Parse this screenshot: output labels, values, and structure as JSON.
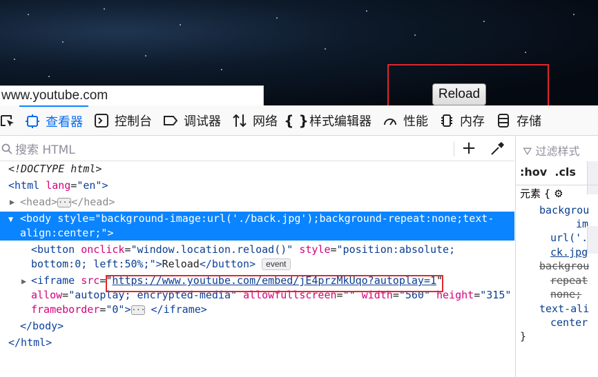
{
  "page": {
    "url_tooltip": "www.youtube.com",
    "reload_button": "Reload"
  },
  "toolbar": {
    "items": [
      {
        "label": "",
        "icon": "pick-element-icon"
      },
      {
        "label": "查看器",
        "icon": "inspector-icon",
        "active": true
      },
      {
        "label": "控制台",
        "icon": "console-icon"
      },
      {
        "label": "调试器",
        "icon": "debugger-icon"
      },
      {
        "label": "网络",
        "icon": "network-icon"
      },
      {
        "label": "样式编辑器",
        "icon": "style-editor-icon"
      },
      {
        "label": "性能",
        "icon": "performance-icon"
      },
      {
        "label": "内存",
        "icon": "memory-icon"
      },
      {
        "label": "存储",
        "icon": "storage-icon"
      }
    ]
  },
  "search": {
    "placeholder": "搜索 HTML"
  },
  "dom": {
    "doctype": "<!DOCTYPE html>",
    "html_open": "<html",
    "html_lang_attr": "lang",
    "html_lang_val": "\"en\"",
    "gt": ">",
    "head_open": "<head>",
    "head_close": "</head>",
    "body_open": "<body",
    "body_style_attr": "style",
    "body_style_val_1": "\"background-image:url('./back.jpg');background-repeat:none;text-",
    "body_style_val_2": "align:center;\"",
    "button_open": "<button",
    "button_onclick_attr": "onclick",
    "button_onclick_val": "\"window.location.reload()\"",
    "button_style_attr": "style",
    "button_style_val_1": "\"position:absolute;",
    "button_style_val_2": "bottom:0; left:50%;\"",
    "button_text": "Reload",
    "button_close": "</button>",
    "event_badge": "event",
    "iframe_open": "<iframe",
    "iframe_src_attr": "src",
    "iframe_src_val": "https://www.youtube.com/embed/jE4przMkUqo?autoplay=1",
    "iframe_allow_attr": "allow",
    "iframe_allow_val": "\"autoplay; encrypted-media\"",
    "iframe_afs_attr": "allowfullscreen",
    "iframe_afs_val": "\"\"",
    "iframe_width_attr": "width",
    "iframe_width_val": "\"560\"",
    "iframe_height_attr": "height",
    "iframe_height_val": "\"315\"",
    "iframe_frameborder_attr": "frameborder",
    "iframe_frameborder_val": "\"0\"",
    "iframe_close": "</iframe>",
    "body_close": "</body>",
    "html_close": "</html>"
  },
  "rules": {
    "filter_placeholder": "过滤样式",
    "hov": ":hov",
    "cls": ".cls",
    "element": "元素 {",
    "lines": [
      "backgrou",
      "im",
      "url('./",
      "ck.jpg",
      "backgrou",
      "repeat",
      "none;",
      "text-ali",
      "center",
      "}"
    ]
  },
  "colors": {
    "accent": "#0a84ff",
    "highlight": "#e2262a"
  }
}
